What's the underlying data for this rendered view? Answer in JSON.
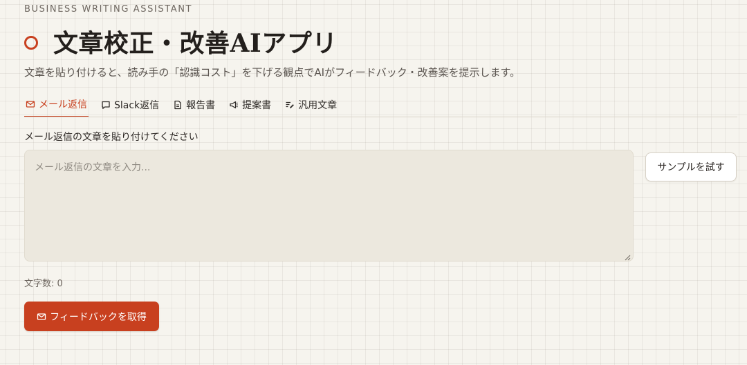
{
  "header": {
    "eyebrow": "BUSINESS WRITING ASSISTANT",
    "title": "文章校正・改善AIアプリ",
    "subtitle": "文章を貼り付けると、読み手の「認識コスト」を下げる観点でAIがフィードバック・改善案を提示します。"
  },
  "tabs": [
    {
      "label": "メール返信",
      "icon": "mail-icon",
      "active": true
    },
    {
      "label": "Slack返信",
      "icon": "chat-bubble-icon",
      "active": false
    },
    {
      "label": "報告書",
      "icon": "document-icon",
      "active": false
    },
    {
      "label": "提案書",
      "icon": "megaphone-icon",
      "active": false
    },
    {
      "label": "汎用文章",
      "icon": "edit-lines-icon",
      "active": false
    }
  ],
  "form": {
    "label": "メール返信の文章を貼り付けてください",
    "placeholder": "メール返信の文章を入力...",
    "value": "",
    "sample_button": "サンプルを試す",
    "char_count": "文字数: 0",
    "submit_label": "フィードバックを取得"
  },
  "colors": {
    "accent": "#c8401f",
    "background": "#f6f4ee",
    "input_bg": "#ece8de"
  }
}
